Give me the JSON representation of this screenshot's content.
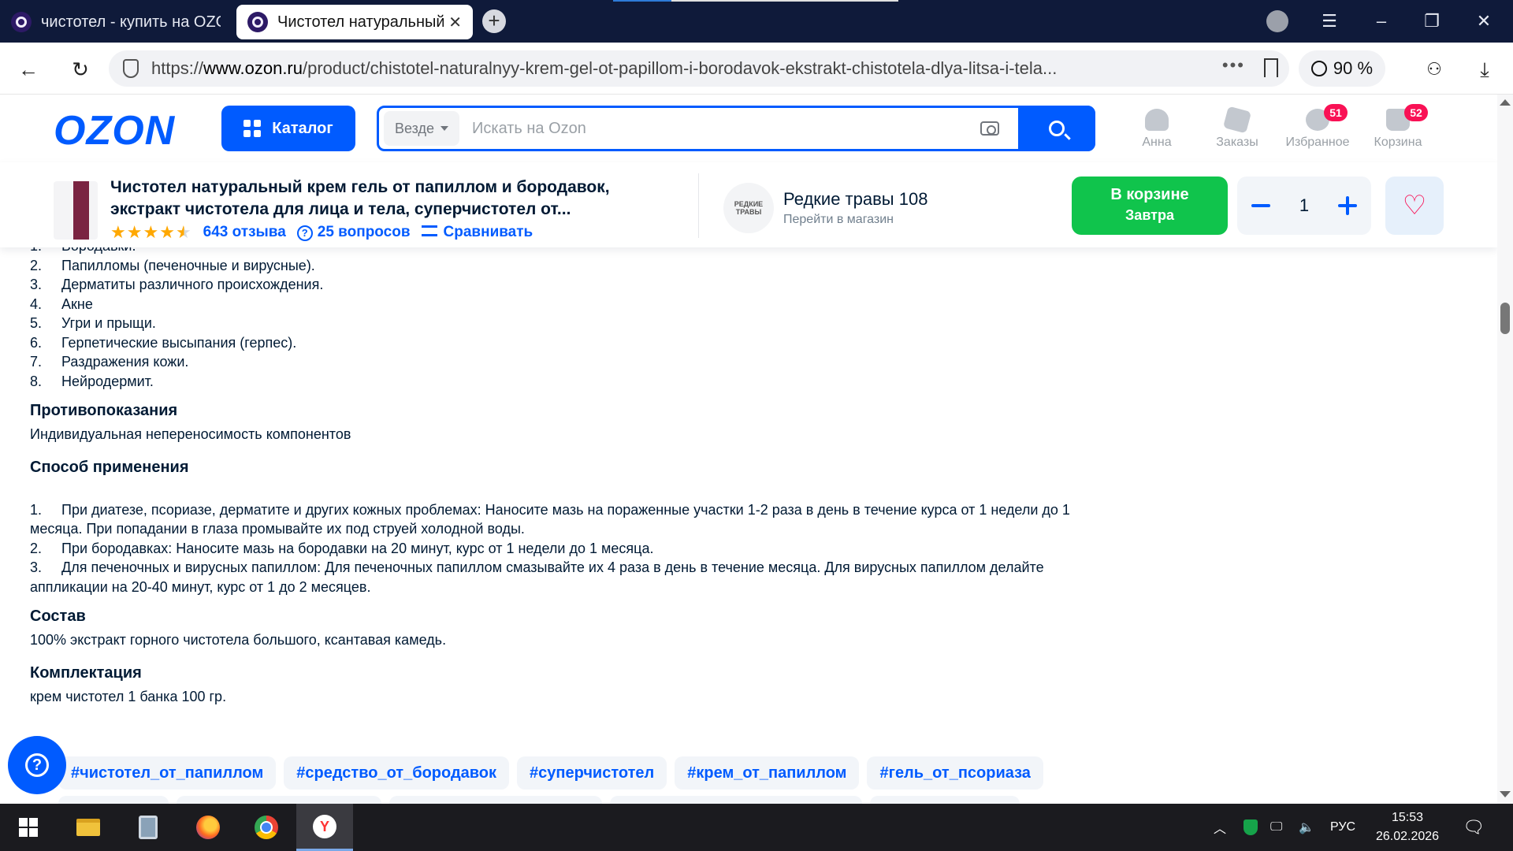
{
  "browser": {
    "tabs": [
      {
        "title": "чистотел - купить на OZON"
      },
      {
        "title": "Чистотел натуральный крем гель от папиллом"
      }
    ],
    "url_prefix": "https://",
    "url_domain": "www.ozon.ru",
    "url_path": "/product/chistotel-naturalnyy-krem-gel-ot-papillom-i-borodavok-ekstrakt-chistotela-dlya-litsa-i-tela...",
    "zoom": "90 %"
  },
  "header": {
    "logo": "OZON",
    "catalog_label": "Каталог",
    "search_scope": "Везде",
    "search_placeholder": "Искать на Ozon",
    "nav": [
      {
        "label": "Анна",
        "icon": "user-icon"
      },
      {
        "label": "Заказы",
        "icon": "box-icon"
      },
      {
        "label": "Избранное",
        "icon": "heart-icon",
        "badge": "51"
      },
      {
        "label": "Корзина",
        "icon": "cart-icon",
        "badge": "52"
      }
    ]
  },
  "product": {
    "title": "Чистотел натуральный крем гель от папиллом и бородавок, экстракт чистотела для лица и тела, суперчистотел от...",
    "reviews": "643 отзыва",
    "questions": "25 вопросов",
    "compare": "Сравнивать",
    "shop_name": "Редкие травы 108",
    "shop_link": "Перейти в магазин",
    "shop_logo_text": "РЕДКИЕ ТРАВЫ",
    "cart_label": "В корзине",
    "cart_sub": "Завтра",
    "quantity": "1",
    "rating": 4.5
  },
  "content": {
    "indications_partial": "Бородавки.",
    "indications": [
      {
        "n": "1.",
        "text": "Бородавки."
      },
      {
        "n": "2.",
        "text": "Папилломы (печеночные и вирусные)."
      },
      {
        "n": "3.",
        "text": "Дерматиты различного происхождения."
      },
      {
        "n": "4.",
        "text": "Акне"
      },
      {
        "n": "5.",
        "text": "Угри и прыщи."
      },
      {
        "n": "6.",
        "text": "Герпетические высыпания (герпес)."
      },
      {
        "n": "7.",
        "text": "Раздражения кожи."
      },
      {
        "n": "8.",
        "text": "Нейродермит."
      }
    ],
    "contra_title": "Противопоказания",
    "contra_text": "Индивидуальная непереносимость компонентов",
    "usage_title": "Способ применения",
    "usage": [
      {
        "n": "1.",
        "text": "При диатезе, псориазе, дерматите и других кожных проблемах: Наносите мазь на пораженные участки 1-2 раза в день в течение курса от 1 недели до 1 месяца. При попадании в глаза промывайте их под струей холодной воды."
      },
      {
        "n": "2.",
        "text": "При бородавках: Наносите мазь на бородавки на 20 минут, курс от 1 недели до 1 месяца."
      },
      {
        "n": "3.",
        "text": "Для печеночных и вирусных папиллом: Для печеночных папиллом смазывайте их 4 раза в день в течение месяца. Для вирусных папиллом делайте аппликации на 20-40 минут, курс от 1 до 2 месяцев."
      }
    ],
    "composition_title": "Состав",
    "composition_text": "100% экстракт горного чистотела большого, ксантавая камедь.",
    "kit_title": "Комплектация",
    "kit_text": "крем чистотел 1 банка 100 гр.",
    "tags": [
      "#чистотел_от_папиллом",
      "#средство_от_бородавок",
      "#суперчистотел",
      "#крем_от_папиллом",
      "#гель_от_псориаза"
    ]
  },
  "taskbar": {
    "lang": "РУС",
    "time": "15:53",
    "date": "26.02.2026"
  },
  "colors": {
    "brand": "#005bff",
    "cart_green": "#10c44c",
    "badge": "#f91155",
    "star": "#ffa800"
  }
}
